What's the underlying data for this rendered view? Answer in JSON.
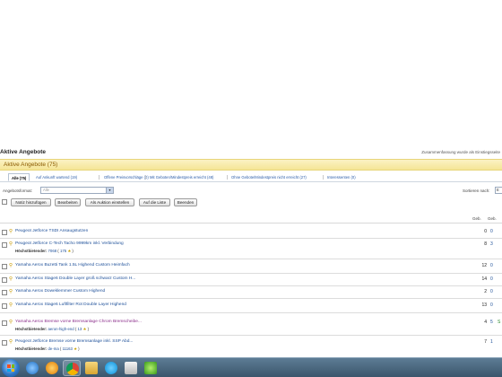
{
  "page": {
    "heading": "Aktive Angebote",
    "summary_note": "Zusammenfassung wurde als Einstiegsseite"
  },
  "section": {
    "title": "Aktive Angebote (75)"
  },
  "filters": [
    {
      "label": "Alle (75)",
      "active": true
    },
    {
      "label": "Auf Ankunft wartend (19)"
    },
    {
      "label": "Offene Preisvorschläge (0)"
    },
    {
      "label": "Mit Geboten/Mindestpreis erreicht (48)"
    },
    {
      "label": "Ohne Gebote/Mindestpreis nicht erreicht (27)"
    },
    {
      "label": "Interessenten (0)"
    }
  ],
  "format": {
    "label": "Angebotsformat:",
    "value": "Alle"
  },
  "sort": {
    "label": "Sortieren nach:",
    "value": "E"
  },
  "toolbar": {
    "note_button": "Notiz hinzufügen",
    "edit_button": "Bearbeiten",
    "auction_button": "Als Auktion einstellen",
    "list_button": "Auf die Liste",
    "end_button": "Beenden"
  },
  "columns": {
    "bids": "Geb.",
    "watchers": "Geb."
  },
  "listings": [
    {
      "title": "Peugeot Jetforce TSDI Ansaugstutzen",
      "bids": "0",
      "watchers": "0"
    },
    {
      "title": "Peugeot Jetforce C-Tech Tacho 9999km inkl. Verbindung",
      "bids": "8",
      "watchers": "3",
      "bidder_label": "Höchstbietender:",
      "bidder_name": "7068",
      "bidder_score": "175"
    },
    {
      "title": "Yamaha Aerox Buzetti Tank 1.5L Highend Custom Heimfach",
      "bids": "12",
      "watchers": "0"
    },
    {
      "title": "Yamaha Aerox Stage6 Double Layer groß schwarz Custom H...",
      "bids": "14",
      "watchers": "0"
    },
    {
      "title": "Yamaha Aerox Doweklemmer Custom Highend",
      "bids": "2",
      "watchers": "0"
    },
    {
      "title": "Yamaha Aerox Stage6 Luftfilter Rot Double Layer Highend",
      "bids": "13",
      "watchers": "0"
    },
    {
      "title": "Yamaha Aerox Bremse vorne Bremsanlage Chrom Bremscheibe...",
      "visited": true,
      "bids": "4",
      "watchers": "5",
      "extra": "S",
      "bidder_label": "Höchstbietender:",
      "bidder_name": "aeron-high-end",
      "bidder_score": "13"
    },
    {
      "title": "Peugeot Jetforce Bremse vorne Bremsanlage inkl. SSP Abd...",
      "bids": "7",
      "watchers": "1",
      "bidder_label": "Höchstbietender:",
      "bidder_name": "de-ma",
      "bidder_score": "11163"
    }
  ],
  "taskbar": {
    "apps": [
      "explorer-icon",
      "media-player-icon",
      "chrome-icon",
      "windows-explorer-icon",
      "skype-icon",
      "email-icon",
      "game-icon"
    ]
  }
}
